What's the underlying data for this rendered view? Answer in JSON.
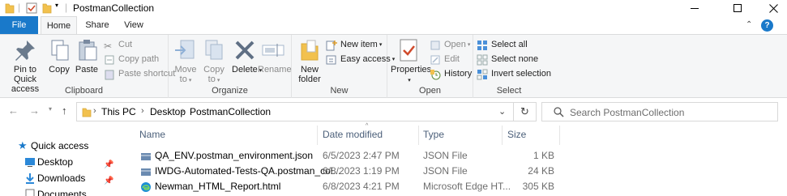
{
  "window": {
    "title": "PostmanCollection"
  },
  "ribbon_tabs": {
    "file": "File",
    "home": "Home",
    "share": "Share",
    "view": "View"
  },
  "clipboard": {
    "pin": "Pin to Quick access",
    "copy": "Copy",
    "paste": "Paste",
    "cut": "Cut",
    "copy_path": "Copy path",
    "paste_shortcut": "Paste shortcut",
    "label": "Clipboard"
  },
  "organize": {
    "move_to": "Move to",
    "copy_to": "Copy to",
    "delete": "Delete",
    "rename": "Rename",
    "label": "Organize"
  },
  "new": {
    "new_folder": "New folder",
    "new_item": "New item",
    "easy_access": "Easy access",
    "label": "New"
  },
  "open": {
    "properties": "Properties",
    "open": "Open",
    "edit": "Edit",
    "history": "History",
    "label": "Open"
  },
  "select": {
    "select_all": "Select all",
    "select_none": "Select none",
    "invert": "Invert selection",
    "label": "Select"
  },
  "address": {
    "crumbs": [
      "This PC",
      "Desktop",
      "PostmanCollection"
    ]
  },
  "search": {
    "placeholder": "Search PostmanCollection"
  },
  "nav_pane": {
    "quick_access": "Quick access",
    "desktop": "Desktop",
    "downloads": "Downloads",
    "documents": "Documents"
  },
  "columns": {
    "name": "Name",
    "date": "Date modified",
    "type": "Type",
    "size": "Size"
  },
  "files": [
    {
      "name": "QA_ENV.postman_environment.json",
      "date": "6/5/2023 2:47 PM",
      "type": "JSON File",
      "size": "1 KB"
    },
    {
      "name": "IWDG-Automated-Tests-QA.postman_col...",
      "date": "6/8/2023 1:19 PM",
      "type": "JSON File",
      "size": "24 KB"
    },
    {
      "name": "Newman_HTML_Report.html",
      "date": "6/8/2023 4:21 PM",
      "type": "Microsoft Edge HT...",
      "size": "305 KB"
    }
  ],
  "colors": {
    "accent": "#1979ca",
    "folder": "#f2c14e",
    "header_text": "#4c607a"
  }
}
